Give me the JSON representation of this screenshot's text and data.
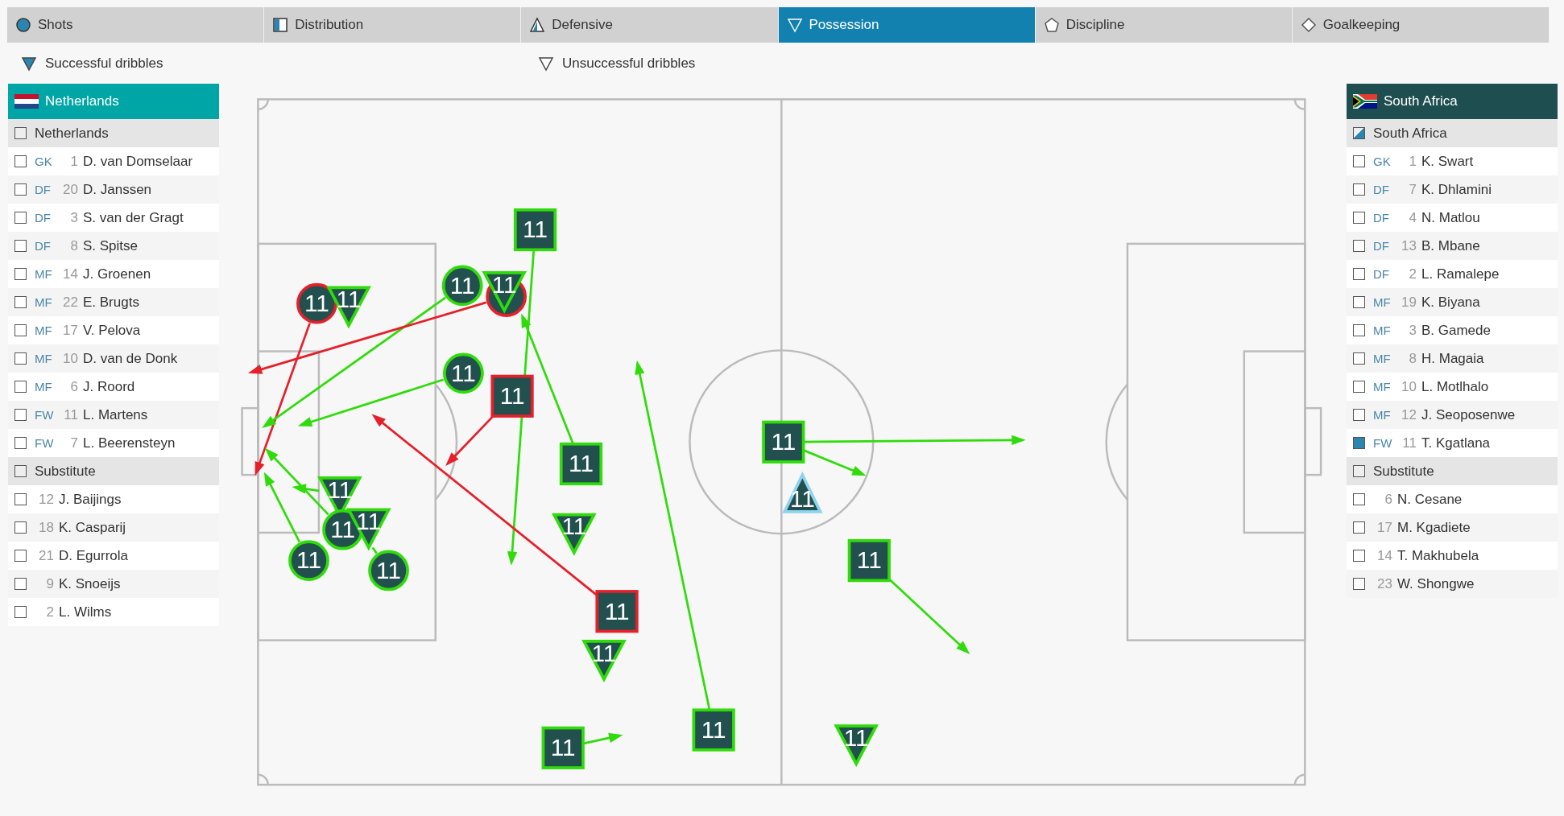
{
  "tabs": [
    {
      "label": "Shots",
      "selected": false
    },
    {
      "label": "Distribution",
      "selected": false
    },
    {
      "label": "Defensive",
      "selected": false
    },
    {
      "label": "Possession",
      "selected": true
    },
    {
      "label": "Discipline",
      "selected": false
    },
    {
      "label": "Goalkeeping",
      "selected": false
    }
  ],
  "legend": [
    {
      "label": "Successful dribbles",
      "kind": "filled"
    },
    {
      "label": "Unsuccessful dribbles",
      "kind": "outline"
    }
  ],
  "teams": [
    {
      "name": "Netherlands",
      "color": "#00a6a6",
      "groups": [
        {
          "label": "Netherlands",
          "indeterminate": false,
          "players": [
            {
              "position": "GK",
              "number": "1",
              "name": "D. van Domselaar",
              "checked": false
            },
            {
              "position": "DF",
              "number": "20",
              "name": "D. Janssen",
              "checked": false
            },
            {
              "position": "DF",
              "number": "3",
              "name": "S. van der Gragt",
              "checked": false
            },
            {
              "position": "DF",
              "number": "8",
              "name": "S. Spitse",
              "checked": false
            },
            {
              "position": "MF",
              "number": "14",
              "name": "J. Groenen",
              "checked": false
            },
            {
              "position": "MF",
              "number": "22",
              "name": "E. Brugts",
              "checked": false
            },
            {
              "position": "MF",
              "number": "17",
              "name": "V. Pelova",
              "checked": false
            },
            {
              "position": "MF",
              "number": "10",
              "name": "D. van de Donk",
              "checked": false
            },
            {
              "position": "MF",
              "number": "6",
              "name": "J. Roord",
              "checked": false
            },
            {
              "position": "FW",
              "number": "11",
              "name": "L. Martens",
              "checked": false
            },
            {
              "position": "FW",
              "number": "7",
              "name": "L. Beerensteyn",
              "checked": false
            }
          ]
        },
        {
          "label": "Substitute",
          "indeterminate": false,
          "players": [
            {
              "number": "12",
              "name": "J. Baijings",
              "checked": false
            },
            {
              "number": "18",
              "name": "K. Casparij",
              "checked": false
            },
            {
              "number": "21",
              "name": "D. Egurrola",
              "checked": false
            },
            {
              "number": "9",
              "name": "K. Snoeijs",
              "checked": false
            },
            {
              "number": "2",
              "name": "L. Wilms",
              "checked": false
            }
          ]
        }
      ]
    },
    {
      "name": "South Africa",
      "color": "#1e4e4f",
      "groups": [
        {
          "label": "South Africa",
          "indeterminate": true,
          "players": [
            {
              "position": "GK",
              "number": "1",
              "name": "K. Swart",
              "checked": false
            },
            {
              "position": "DF",
              "number": "7",
              "name": "K. Dhlamini",
              "checked": false
            },
            {
              "position": "DF",
              "number": "4",
              "name": "N. Matlou",
              "checked": false
            },
            {
              "position": "DF",
              "number": "13",
              "name": "B. Mbane",
              "checked": false
            },
            {
              "position": "DF",
              "number": "2",
              "name": "L. Ramalepe",
              "checked": false
            },
            {
              "position": "MF",
              "number": "19",
              "name": "K. Biyana",
              "checked": false
            },
            {
              "position": "MF",
              "number": "3",
              "name": "B. Gamede",
              "checked": false
            },
            {
              "position": "MF",
              "number": "8",
              "name": "H. Magaia",
              "checked": false
            },
            {
              "position": "MF",
              "number": "10",
              "name": "L. Motlhalo",
              "checked": false
            },
            {
              "position": "MF",
              "number": "12",
              "name": "J. Seoposenwe",
              "checked": false
            },
            {
              "position": "FW",
              "number": "11",
              "name": "T. Kgatlana",
              "checked": true
            }
          ]
        },
        {
          "label": "Substitute",
          "indeterminate": false,
          "players": [
            {
              "number": "6",
              "name": "N. Cesane",
              "checked": false
            },
            {
              "number": "17",
              "name": "M. Kgadiete",
              "checked": false
            },
            {
              "number": "14",
              "name": "T. Makhubela",
              "checked": false
            },
            {
              "number": "23",
              "name": "W. Shongwe",
              "checked": false
            }
          ]
        }
      ]
    }
  ],
  "events": [
    {
      "kind": "circle",
      "color": "#e5202b",
      "label": "11"
    },
    {
      "kind": "triangle",
      "color": "#2fdc0a",
      "label": "11"
    },
    {
      "kind": "circle",
      "color": "#2fdc0a",
      "label": "11"
    },
    {
      "kind": "circle",
      "color": "#e5202b"
    },
    {
      "kind": "triangle",
      "color": "#2fdc0a",
      "label": "11"
    },
    {
      "kind": "square",
      "color": "#2fdc0a",
      "label": "11"
    },
    {
      "kind": "circle",
      "color": "#2fdc0a",
      "label": "11"
    },
    {
      "kind": "square",
      "color": "#e5202b",
      "label": "11"
    },
    {
      "kind": "square",
      "color": "#2fdc0a",
      "label": "11"
    },
    {
      "kind": "triangle",
      "color": "#2fdc0a",
      "label": "11"
    },
    {
      "kind": "circle",
      "color": "#2fdc0a",
      "label": "11"
    },
    {
      "kind": "triangle",
      "color": "#2fdc0a",
      "label": "11"
    },
    {
      "kind": "circle",
      "color": "#2fdc0a",
      "label": "11"
    },
    {
      "kind": "circle",
      "color": "#2fdc0a",
      "label": "11"
    },
    {
      "kind": "triangle",
      "color": "#2fdc0a",
      "label": "11"
    },
    {
      "kind": "square",
      "color": "#e5202b",
      "label": "11"
    },
    {
      "kind": "triangle",
      "color": "#2fdc0a",
      "label": "11"
    },
    {
      "kind": "square",
      "color": "#2fdc0a",
      "label": "11"
    },
    {
      "kind": "square",
      "color": "#2fdc0a",
      "label": "11"
    },
    {
      "kind": "square",
      "color": "#2fdc0a",
      "label": "11"
    },
    {
      "kind": "uptriangle",
      "color": "#8fd3f0",
      "label": "11"
    },
    {
      "kind": "square",
      "color": "#2fdc0a",
      "label": "11"
    },
    {
      "kind": "triangle",
      "color": "#2fdc0a",
      "label": "11"
    }
  ]
}
